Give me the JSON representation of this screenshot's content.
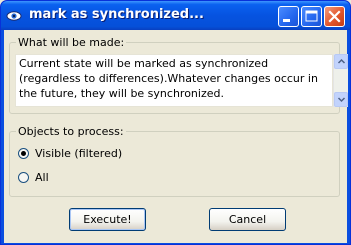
{
  "window": {
    "title": "mark as synchronized..."
  },
  "description_group": {
    "legend": "What will be made:",
    "text": "Current state will be marked as synchronized (regardless to differences).Whatever changes occur in the future, they will be synchronized."
  },
  "objects_group": {
    "legend": "Objects to process:",
    "options": [
      {
        "label": "Visible (filtered)",
        "selected": true
      },
      {
        "label": "All",
        "selected": false
      }
    ]
  },
  "buttons": {
    "execute": "Execute!",
    "cancel": "Cancel"
  },
  "icons": {
    "app": "eye-icon",
    "minimize": "minimize-icon",
    "maximize": "maximize-icon",
    "close": "close-icon"
  }
}
